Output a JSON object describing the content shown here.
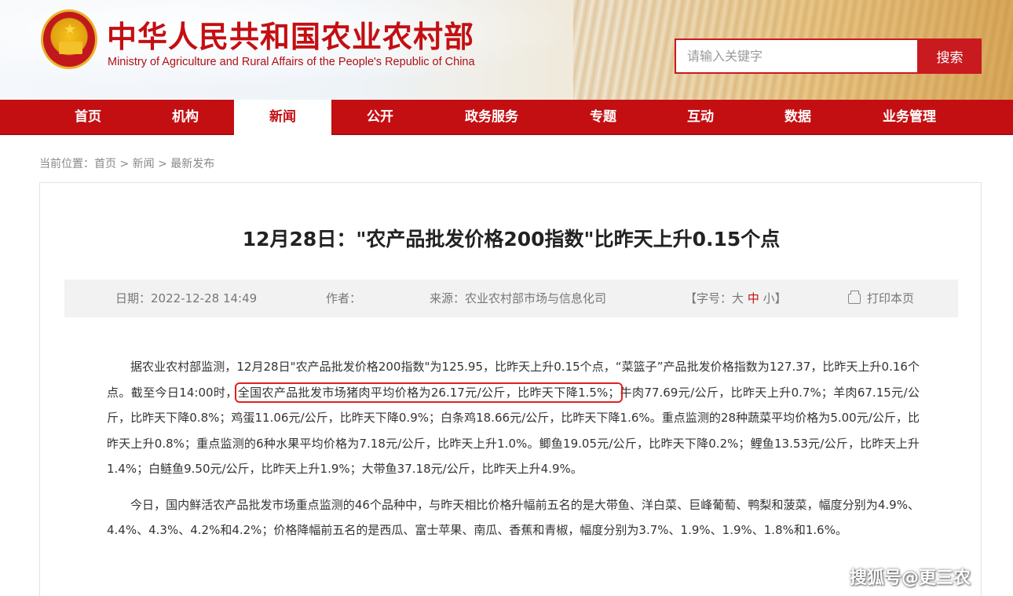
{
  "header": {
    "title_cn": "中华人民共和国农业农村部",
    "title_en": "Ministry of Agriculture and Rural Affairs of the People's Republic of China",
    "emblem_icon": "national-emblem-icon"
  },
  "search": {
    "placeholder": "请输入关键字",
    "button_label": "搜索"
  },
  "nav": {
    "items": [
      {
        "label": "首页"
      },
      {
        "label": "机构"
      },
      {
        "label": "新闻",
        "active": true
      },
      {
        "label": "公开"
      },
      {
        "label": "政务服务"
      },
      {
        "label": "专题"
      },
      {
        "label": "互动"
      },
      {
        "label": "数据"
      },
      {
        "label": "业务管理"
      }
    ]
  },
  "breadcrumb": {
    "prefix": "当前位置：",
    "items": [
      "首页",
      "新闻",
      "最新发布"
    ],
    "separator": " > "
  },
  "article": {
    "title": "12月28日：\"农产品批发价格200指数\"比昨天上升0.15个点",
    "meta": {
      "date": "日期：2022-12-28 14:49",
      "author": "作者：",
      "source": "来源：农业农村部市场与信息化司",
      "font_label_open": "【字号：",
      "font_large": "大",
      "font_medium": "中",
      "font_small": "小",
      "font_label_close": "】",
      "print_label": "打印本页"
    },
    "paragraph1_before": "据农业农村部监测，12月28日\"农产品批发价格200指数\"为125.95，比昨天上升0.15个点，“菜篮子”产品批发价格指数为127.37，比昨天上升0.16个点。截至今日14:00时，",
    "paragraph1_highlight": "全国农产品批发市场猪肉平均价格为26.17元/公斤，比昨天下降1.5%；",
    "paragraph1_after": "牛肉77.69元/公斤，比昨天上升0.7%；羊肉67.15元/公斤，比昨天下降0.8%；鸡蛋11.06元/公斤，比昨天下降0.9%；白条鸡18.66元/公斤，比昨天下降1.6%。重点监测的28种蔬菜平均价格为5.00元/公斤，比昨天上升0.8%；重点监测的6种水果平均价格为7.18元/公斤，比昨天上升1.0%。鲫鱼19.05元/公斤，比昨天下降0.2%；鲤鱼13.53元/公斤，比昨天上升1.4%；白鲢鱼9.50元/公斤，比昨天上升1.9%；大带鱼37.18元/公斤，比昨天上升4.9%。",
    "paragraph2": "今日，国内鲜活农产品批发市场重点监测的46个品种中，与昨天相比价格升幅前五名的是大带鱼、洋白菜、巨峰葡萄、鸭梨和菠菜，幅度分别为4.9%、4.4%、4.3%、4.2%和4.2%；价格降幅前五名的是西瓜、富士苹果、南瓜、香蕉和青椒，幅度分别为3.7%、1.9%、1.9%、1.8%和1.6%。"
  },
  "watermark": "搜狐号@更三农",
  "colors": {
    "brand_red": "#c40f12",
    "highlight_border": "#e0211f"
  }
}
